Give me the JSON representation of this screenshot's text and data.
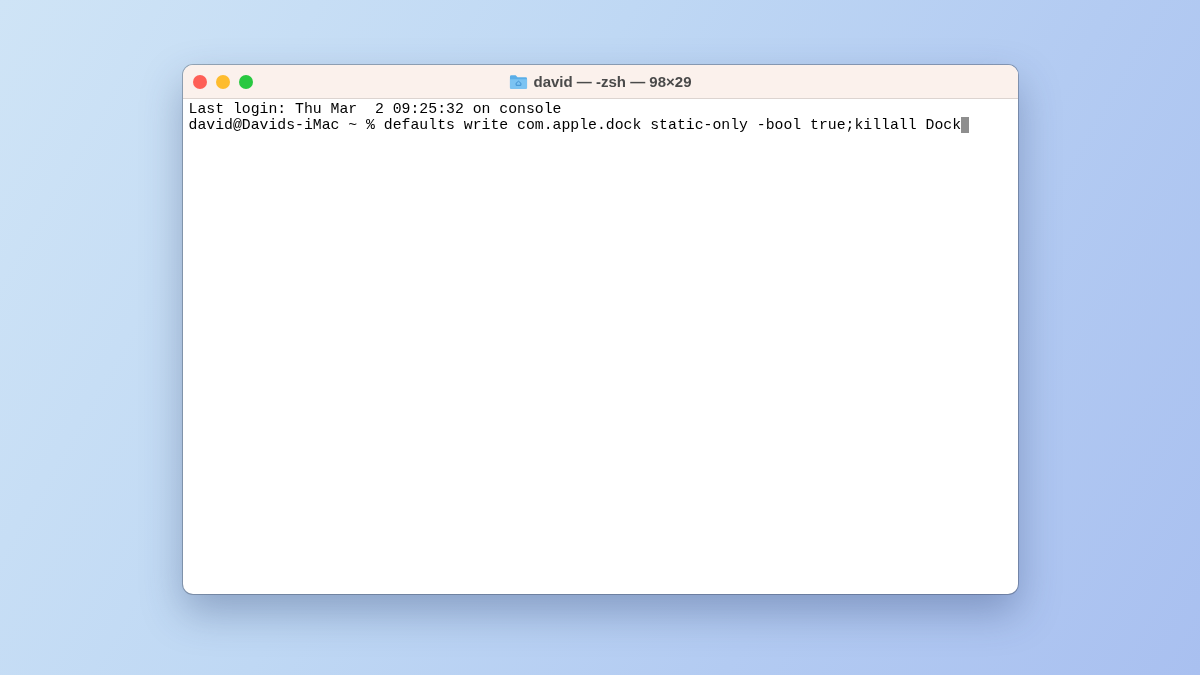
{
  "window": {
    "title": "david — -zsh — 98×29"
  },
  "terminal": {
    "lines": [
      {
        "text": "Last login: Thu Mar  2 09:25:32 on console",
        "cursor": false
      },
      {
        "text": "david@Davids-iMac ~ % defaults write com.apple.dock static-only -bool true;killall Dock",
        "cursor": true
      }
    ]
  }
}
